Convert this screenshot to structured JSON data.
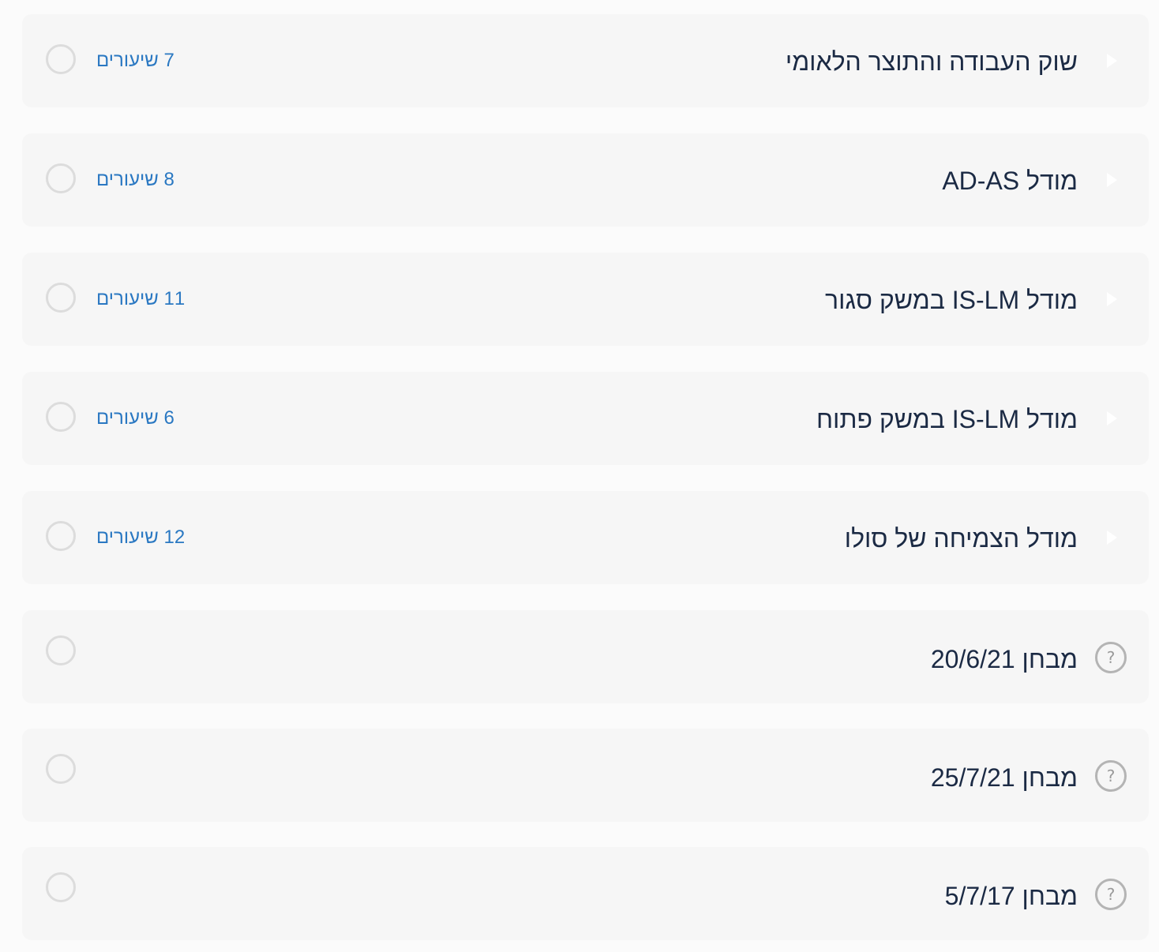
{
  "items": [
    {
      "title": "שוק העבודה והתוצר הלאומי",
      "count": "7 שיעורים"
    },
    {
      "title": "מודל AD-AS",
      "count": "8 שיעורים"
    },
    {
      "title": "מודל IS-LM במשק סגור",
      "count": "11 שיעורים"
    },
    {
      "title": "מודל IS-LM במשק פתוח",
      "count": "6 שיעורים"
    },
    {
      "title": "מודל הצמיחה של סולו",
      "count": "12 שיעורים"
    }
  ],
  "quizzes": [
    {
      "title": "מבחן 20/6/21",
      "icon": "?"
    },
    {
      "title": "מבחן 25/7/21",
      "icon": "?"
    },
    {
      "title": "מבחן 5/7/17",
      "icon": "?"
    }
  ]
}
